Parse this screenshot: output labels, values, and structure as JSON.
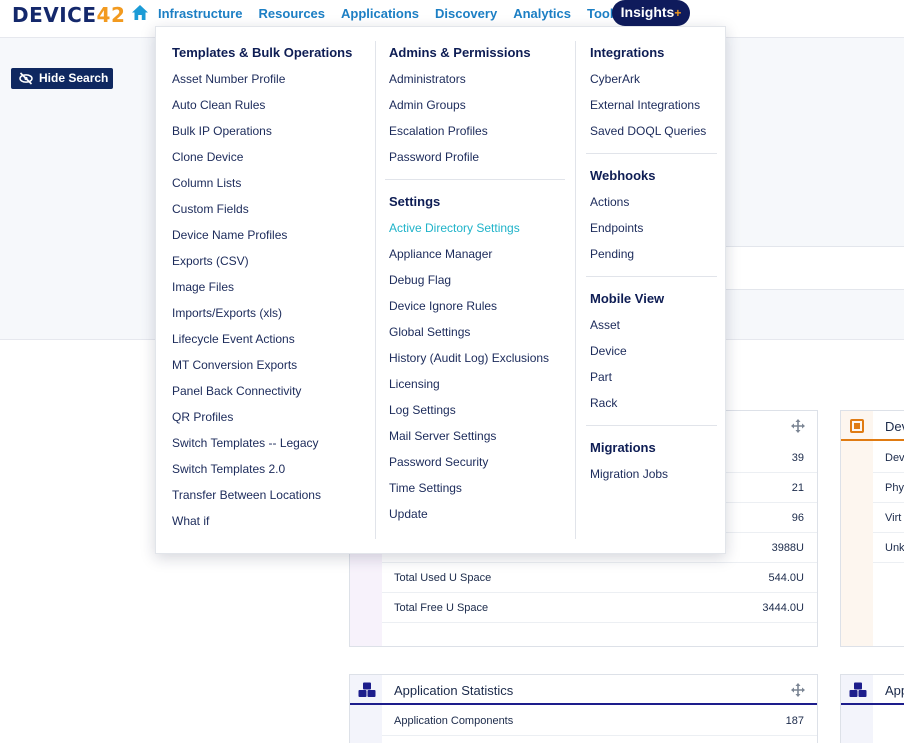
{
  "brand": {
    "logo_text": "DEVICE",
    "logo_num": "42"
  },
  "nav": {
    "items": [
      "Infrastructure",
      "Resources",
      "Applications",
      "Discovery",
      "Analytics",
      "Tools"
    ],
    "insights_label": "Insights",
    "insights_plus": "+"
  },
  "hide_search_label": "Hide Search",
  "menu": {
    "col1": {
      "title": "Templates & Bulk Operations",
      "items": [
        "Asset Number Profile",
        "Auto Clean Rules",
        "Bulk IP Operations",
        "Clone Device",
        "Column Lists",
        "Custom Fields",
        "Device Name Profiles",
        "Exports (CSV)",
        "Image Files",
        "Imports/Exports (xls)",
        "Lifecycle Event Actions",
        "MT Conversion Exports",
        "Panel Back Connectivity",
        "QR Profiles",
        "Switch Templates -- Legacy",
        "Switch Templates 2.0",
        "Transfer Between Locations",
        "What if"
      ]
    },
    "col2": {
      "admins_title": "Admins & Permissions",
      "admins_items": [
        "Administrators",
        "Admin Groups",
        "Escalation Profiles",
        "Password Profile"
      ],
      "settings_title": "Settings",
      "settings_items": [
        "Active Directory Settings",
        "Appliance Manager",
        "Debug Flag",
        "Device Ignore Rules",
        "Global Settings",
        "History (Audit Log) Exclusions",
        "Licensing",
        "Log Settings",
        "Mail Server Settings",
        "Password Security",
        "Time Settings",
        "Update"
      ]
    },
    "col3": {
      "integrations_title": "Integrations",
      "integrations_items": [
        "CyberArk",
        "External Integrations",
        "Saved DOQL Queries"
      ],
      "webhooks_title": "Webhooks",
      "webhooks_items": [
        "Actions",
        "Endpoints",
        "Pending"
      ],
      "mobile_title": "Mobile View",
      "mobile_items": [
        "Asset",
        "Device",
        "Part",
        "Rack"
      ],
      "migrations_title": "Migrations",
      "migrations_items": [
        "Migration Jobs"
      ]
    }
  },
  "rack_panel": {
    "rows": [
      {
        "label": "",
        "value": "39"
      },
      {
        "label": "",
        "value": "21"
      },
      {
        "label": "",
        "value": "96"
      },
      {
        "label": "",
        "value": "3988U"
      },
      {
        "label": "Total Used U Space",
        "value": "544.0U"
      },
      {
        "label": "Total Free U Space",
        "value": "3444.0U"
      }
    ]
  },
  "device_panel": {
    "title": "Dev",
    "rows": [
      "Dev",
      "Phy",
      "Virt",
      "Unk"
    ]
  },
  "app_panel": {
    "title": "Application Statistics",
    "rows": [
      {
        "label": "Application Components",
        "value": "187"
      }
    ]
  },
  "app_panel_right": {
    "title": "App"
  },
  "colors": {
    "brand_navy": "#0f1b5c",
    "link_blue": "#1c7fc4",
    "accent_orange": "#f29a1f",
    "active_teal": "#1fb3c9"
  }
}
